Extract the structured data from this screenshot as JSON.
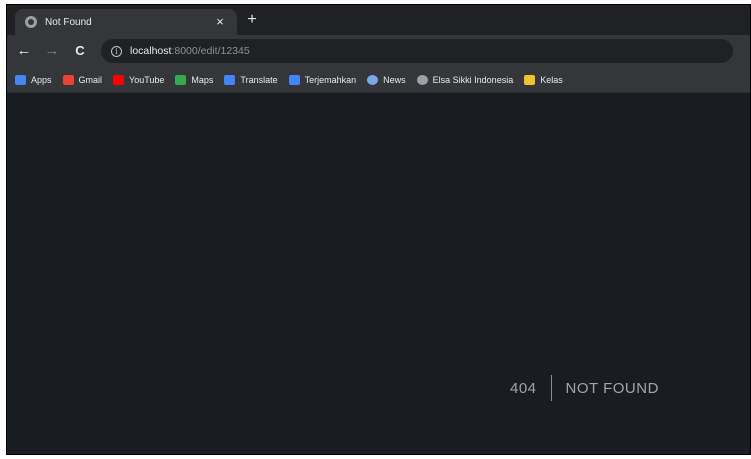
{
  "browser": {
    "tab": {
      "title": "Not Found",
      "close_symbol": "×"
    },
    "new_tab_symbol": "+",
    "toolbar": {
      "back_symbol": "←",
      "forward_symbol": "→",
      "reload_symbol": "C",
      "info_symbol": "i",
      "url_host": "localhost",
      "url_path": ":8000/edit/12345"
    },
    "bookmarks": [
      {
        "label": "Apps",
        "icon": "apps-grid-icon",
        "color": "#4285f4"
      },
      {
        "label": "Gmail",
        "icon": "gmail-icon",
        "color": "#ea4335"
      },
      {
        "label": "YouTube",
        "icon": "youtube-icon",
        "color": "#ff0000"
      },
      {
        "label": "Maps",
        "icon": "maps-icon",
        "color": "#34a853"
      },
      {
        "label": "Translate",
        "icon": "translate-icon",
        "color": "#4285f4"
      },
      {
        "label": "Terjemahkan",
        "icon": "translate-icon",
        "color": "#4285f4"
      },
      {
        "label": "News",
        "icon": "news-icon",
        "color": "#7aa7e8"
      },
      {
        "label": "Elsa Sikki Indonesia",
        "icon": "elsa-icon",
        "color": "#9aa0a6"
      },
      {
        "label": "Kelas",
        "icon": "classroom-icon",
        "color": "#f2c230"
      }
    ]
  },
  "page": {
    "status_code": "404",
    "status_message": "NOT FOUND",
    "background_color": "#1a1c23"
  }
}
